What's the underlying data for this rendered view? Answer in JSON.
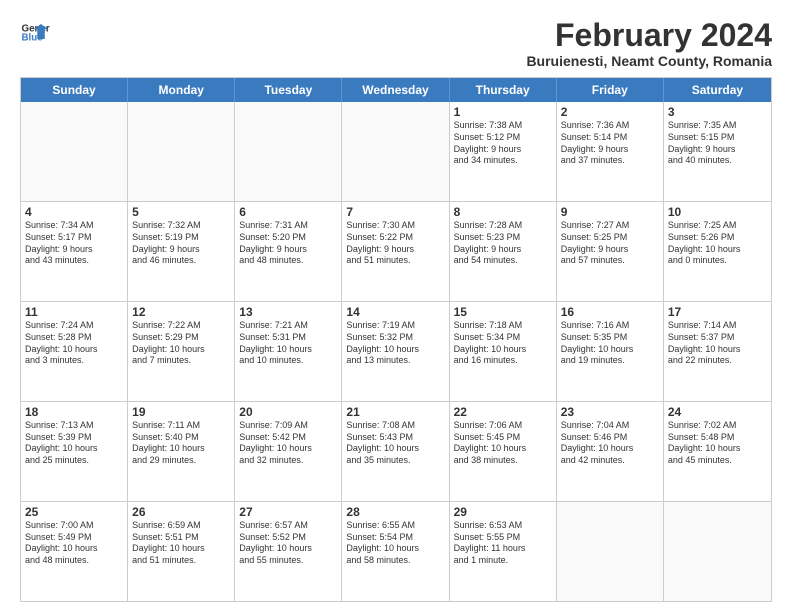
{
  "logo": {
    "line1": "General",
    "line2": "Blue"
  },
  "title": "February 2024",
  "subtitle": "Buruienesti, Neamt County, Romania",
  "header_days": [
    "Sunday",
    "Monday",
    "Tuesday",
    "Wednesday",
    "Thursday",
    "Friday",
    "Saturday"
  ],
  "rows": [
    [
      {
        "day": "",
        "lines": []
      },
      {
        "day": "",
        "lines": []
      },
      {
        "day": "",
        "lines": []
      },
      {
        "day": "",
        "lines": []
      },
      {
        "day": "1",
        "lines": [
          "Sunrise: 7:38 AM",
          "Sunset: 5:12 PM",
          "Daylight: 9 hours",
          "and 34 minutes."
        ]
      },
      {
        "day": "2",
        "lines": [
          "Sunrise: 7:36 AM",
          "Sunset: 5:14 PM",
          "Daylight: 9 hours",
          "and 37 minutes."
        ]
      },
      {
        "day": "3",
        "lines": [
          "Sunrise: 7:35 AM",
          "Sunset: 5:15 PM",
          "Daylight: 9 hours",
          "and 40 minutes."
        ]
      }
    ],
    [
      {
        "day": "4",
        "lines": [
          "Sunrise: 7:34 AM",
          "Sunset: 5:17 PM",
          "Daylight: 9 hours",
          "and 43 minutes."
        ]
      },
      {
        "day": "5",
        "lines": [
          "Sunrise: 7:32 AM",
          "Sunset: 5:19 PM",
          "Daylight: 9 hours",
          "and 46 minutes."
        ]
      },
      {
        "day": "6",
        "lines": [
          "Sunrise: 7:31 AM",
          "Sunset: 5:20 PM",
          "Daylight: 9 hours",
          "and 48 minutes."
        ]
      },
      {
        "day": "7",
        "lines": [
          "Sunrise: 7:30 AM",
          "Sunset: 5:22 PM",
          "Daylight: 9 hours",
          "and 51 minutes."
        ]
      },
      {
        "day": "8",
        "lines": [
          "Sunrise: 7:28 AM",
          "Sunset: 5:23 PM",
          "Daylight: 9 hours",
          "and 54 minutes."
        ]
      },
      {
        "day": "9",
        "lines": [
          "Sunrise: 7:27 AM",
          "Sunset: 5:25 PM",
          "Daylight: 9 hours",
          "and 57 minutes."
        ]
      },
      {
        "day": "10",
        "lines": [
          "Sunrise: 7:25 AM",
          "Sunset: 5:26 PM",
          "Daylight: 10 hours",
          "and 0 minutes."
        ]
      }
    ],
    [
      {
        "day": "11",
        "lines": [
          "Sunrise: 7:24 AM",
          "Sunset: 5:28 PM",
          "Daylight: 10 hours",
          "and 3 minutes."
        ]
      },
      {
        "day": "12",
        "lines": [
          "Sunrise: 7:22 AM",
          "Sunset: 5:29 PM",
          "Daylight: 10 hours",
          "and 7 minutes."
        ]
      },
      {
        "day": "13",
        "lines": [
          "Sunrise: 7:21 AM",
          "Sunset: 5:31 PM",
          "Daylight: 10 hours",
          "and 10 minutes."
        ]
      },
      {
        "day": "14",
        "lines": [
          "Sunrise: 7:19 AM",
          "Sunset: 5:32 PM",
          "Daylight: 10 hours",
          "and 13 minutes."
        ]
      },
      {
        "day": "15",
        "lines": [
          "Sunrise: 7:18 AM",
          "Sunset: 5:34 PM",
          "Daylight: 10 hours",
          "and 16 minutes."
        ]
      },
      {
        "day": "16",
        "lines": [
          "Sunrise: 7:16 AM",
          "Sunset: 5:35 PM",
          "Daylight: 10 hours",
          "and 19 minutes."
        ]
      },
      {
        "day": "17",
        "lines": [
          "Sunrise: 7:14 AM",
          "Sunset: 5:37 PM",
          "Daylight: 10 hours",
          "and 22 minutes."
        ]
      }
    ],
    [
      {
        "day": "18",
        "lines": [
          "Sunrise: 7:13 AM",
          "Sunset: 5:39 PM",
          "Daylight: 10 hours",
          "and 25 minutes."
        ]
      },
      {
        "day": "19",
        "lines": [
          "Sunrise: 7:11 AM",
          "Sunset: 5:40 PM",
          "Daylight: 10 hours",
          "and 29 minutes."
        ]
      },
      {
        "day": "20",
        "lines": [
          "Sunrise: 7:09 AM",
          "Sunset: 5:42 PM",
          "Daylight: 10 hours",
          "and 32 minutes."
        ]
      },
      {
        "day": "21",
        "lines": [
          "Sunrise: 7:08 AM",
          "Sunset: 5:43 PM",
          "Daylight: 10 hours",
          "and 35 minutes."
        ]
      },
      {
        "day": "22",
        "lines": [
          "Sunrise: 7:06 AM",
          "Sunset: 5:45 PM",
          "Daylight: 10 hours",
          "and 38 minutes."
        ]
      },
      {
        "day": "23",
        "lines": [
          "Sunrise: 7:04 AM",
          "Sunset: 5:46 PM",
          "Daylight: 10 hours",
          "and 42 minutes."
        ]
      },
      {
        "day": "24",
        "lines": [
          "Sunrise: 7:02 AM",
          "Sunset: 5:48 PM",
          "Daylight: 10 hours",
          "and 45 minutes."
        ]
      }
    ],
    [
      {
        "day": "25",
        "lines": [
          "Sunrise: 7:00 AM",
          "Sunset: 5:49 PM",
          "Daylight: 10 hours",
          "and 48 minutes."
        ]
      },
      {
        "day": "26",
        "lines": [
          "Sunrise: 6:59 AM",
          "Sunset: 5:51 PM",
          "Daylight: 10 hours",
          "and 51 minutes."
        ]
      },
      {
        "day": "27",
        "lines": [
          "Sunrise: 6:57 AM",
          "Sunset: 5:52 PM",
          "Daylight: 10 hours",
          "and 55 minutes."
        ]
      },
      {
        "day": "28",
        "lines": [
          "Sunrise: 6:55 AM",
          "Sunset: 5:54 PM",
          "Daylight: 10 hours",
          "and 58 minutes."
        ]
      },
      {
        "day": "29",
        "lines": [
          "Sunrise: 6:53 AM",
          "Sunset: 5:55 PM",
          "Daylight: 11 hours",
          "and 1 minute."
        ]
      },
      {
        "day": "",
        "lines": []
      },
      {
        "day": "",
        "lines": []
      }
    ]
  ]
}
